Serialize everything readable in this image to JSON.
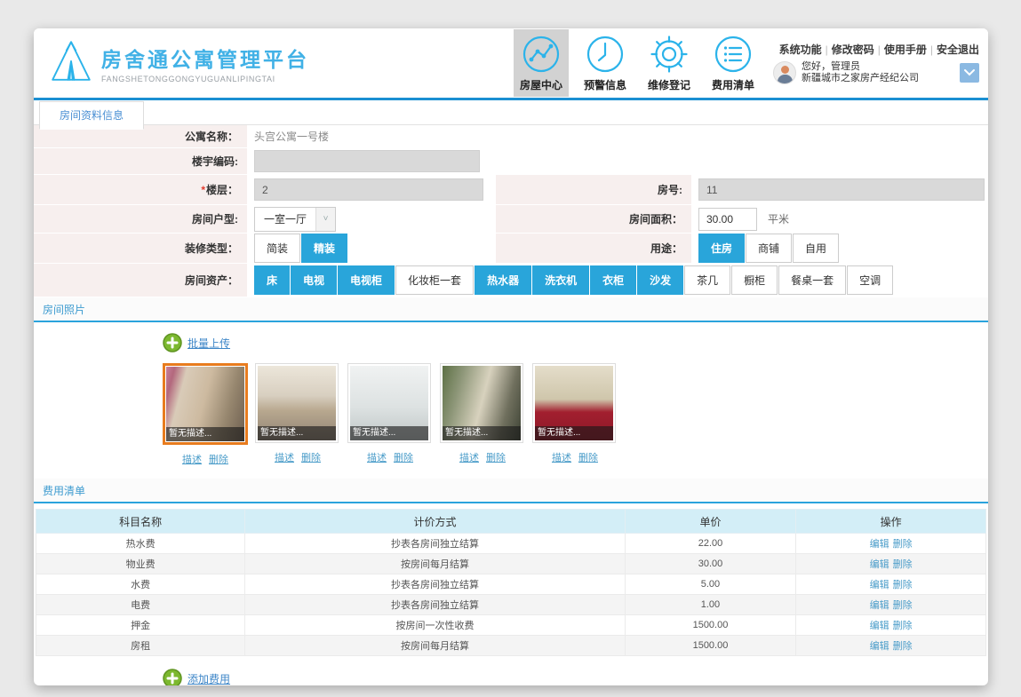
{
  "app": {
    "title": "房舍通公寓管理平台",
    "subtitle": "FANGSHETONGGONGYUGUANLIPINGTAI"
  },
  "colors": {
    "accent_blue": "#29a5da",
    "header_line_blue": "#1b8fd2",
    "selected_photo_border": "#e87c1e",
    "add_icon_green": "#7cb82f",
    "table_header_bg": "#d3eef7",
    "form_label_bg": "#f7efee"
  },
  "header": {
    "nav": [
      {
        "label": "房屋中心",
        "icon": "chart-icon",
        "active": true
      },
      {
        "label": "预警信息",
        "icon": "clock-icon",
        "active": false
      },
      {
        "label": "维修登记",
        "icon": "gear-icon",
        "active": false
      },
      {
        "label": "费用清单",
        "icon": "list-icon",
        "active": false
      }
    ],
    "system_links": [
      "系统功能",
      "修改密码",
      "使用手册",
      "安全退出"
    ],
    "separator": "|",
    "user": {
      "greeting": "您好，管理员",
      "company": "新疆城市之家房产经纪公司"
    }
  },
  "tabs": [
    {
      "label": "房间资料信息",
      "active": true
    }
  ],
  "form": {
    "apartment_name": {
      "label": "公寓名称：",
      "value": "头宫公寓一号楼"
    },
    "building_code": {
      "label": "楼宇编码:",
      "value": ""
    },
    "floor": {
      "label": "楼层：",
      "required_mark": "*",
      "value": "2"
    },
    "room_no": {
      "label": "房号:",
      "value": "11"
    },
    "room_type": {
      "label": "房间户型:",
      "value": "一室一厅"
    },
    "room_area": {
      "label": "房间面积：",
      "value": "30.00",
      "unit": "平米"
    },
    "decoration": {
      "label": "装修类型：",
      "options": [
        {
          "label": "简装",
          "selected": false
        },
        {
          "label": "精装",
          "selected": true
        }
      ]
    },
    "usage": {
      "label": "用途：",
      "options": [
        {
          "label": "住房",
          "selected": true
        },
        {
          "label": "商铺",
          "selected": false
        },
        {
          "label": "自用",
          "selected": false
        }
      ]
    },
    "assets": {
      "label": "房间资产：",
      "options": [
        {
          "label": "床",
          "selected": true
        },
        {
          "label": "电视",
          "selected": true
        },
        {
          "label": "电视柜",
          "selected": true
        },
        {
          "label": "化妆柜一套",
          "selected": false
        },
        {
          "label": "热水器",
          "selected": true
        },
        {
          "label": "洗衣机",
          "selected": true
        },
        {
          "label": "衣柜",
          "selected": true
        },
        {
          "label": "沙发",
          "selected": true
        },
        {
          "label": "茶几",
          "selected": false
        },
        {
          "label": "橱柜",
          "selected": false
        },
        {
          "label": "餐桌一套",
          "selected": false
        },
        {
          "label": "空调",
          "selected": false
        }
      ]
    }
  },
  "photos": {
    "section_title": "房间照片",
    "upload_label": "批量上传",
    "caption": "暂无描述...",
    "link_desc": "描述",
    "link_del": "删除",
    "items": [
      {
        "kind": "living-room-photo",
        "selected": true
      },
      {
        "kind": "empty-room-photo",
        "selected": false
      },
      {
        "kind": "bathroom-photo",
        "selected": false
      },
      {
        "kind": "hallway-photo",
        "selected": false
      },
      {
        "kind": "kitchen-photo",
        "selected": false
      }
    ]
  },
  "fees": {
    "section_title": "费用清单",
    "add_label": "添加费用",
    "table": {
      "headers": [
        "科目名称",
        "计价方式",
        "单价",
        "操作"
      ],
      "row_actions": [
        "编辑",
        "删除"
      ],
      "rows": [
        [
          "热水费",
          "抄表各房间独立结算",
          "22.00"
        ],
        [
          "物业费",
          "按房间每月结算",
          "30.00"
        ],
        [
          "水费",
          "抄表各房间独立结算",
          "5.00"
        ],
        [
          "电费",
          "抄表各房间独立结算",
          "1.00"
        ],
        [
          "押金",
          "按房间一次性收费",
          "1500.00"
        ],
        [
          "房租",
          "按房间每月结算",
          "1500.00"
        ]
      ]
    }
  }
}
